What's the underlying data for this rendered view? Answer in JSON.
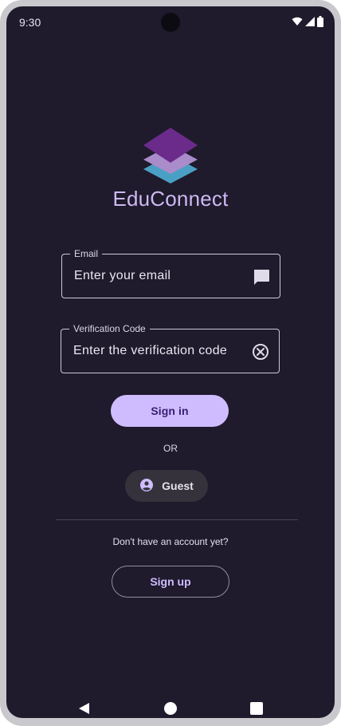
{
  "status_bar": {
    "time": "9:30",
    "icons": [
      "wifi-icon",
      "signal-icon",
      "battery-icon"
    ]
  },
  "app": {
    "title": "EduConnect",
    "logo_icon": "stacked-layers-logo"
  },
  "form": {
    "email": {
      "label": "Email",
      "placeholder": "Enter your email",
      "icon": "message-icon"
    },
    "verification": {
      "label": "Verification Code",
      "placeholder": "Enter the verification code",
      "icon": "clear-circle-icon"
    }
  },
  "actions": {
    "sign_in_label": "Sign in",
    "or_label": "OR",
    "guest_label": "Guest",
    "guest_icon": "account-circle-icon",
    "no_account_text": "Don't have an account yet?",
    "sign_up_label": "Sign up"
  },
  "nav_bar": {
    "buttons": [
      "back-icon",
      "home-icon",
      "recents-icon"
    ]
  },
  "colors": {
    "background": "#1f1a2c",
    "accent": "#cfbcff",
    "title": "#cdb9f2",
    "logo_top": "#6b2b8a",
    "logo_middle": "#a98cc9",
    "logo_bottom": "#4aa0c4"
  }
}
